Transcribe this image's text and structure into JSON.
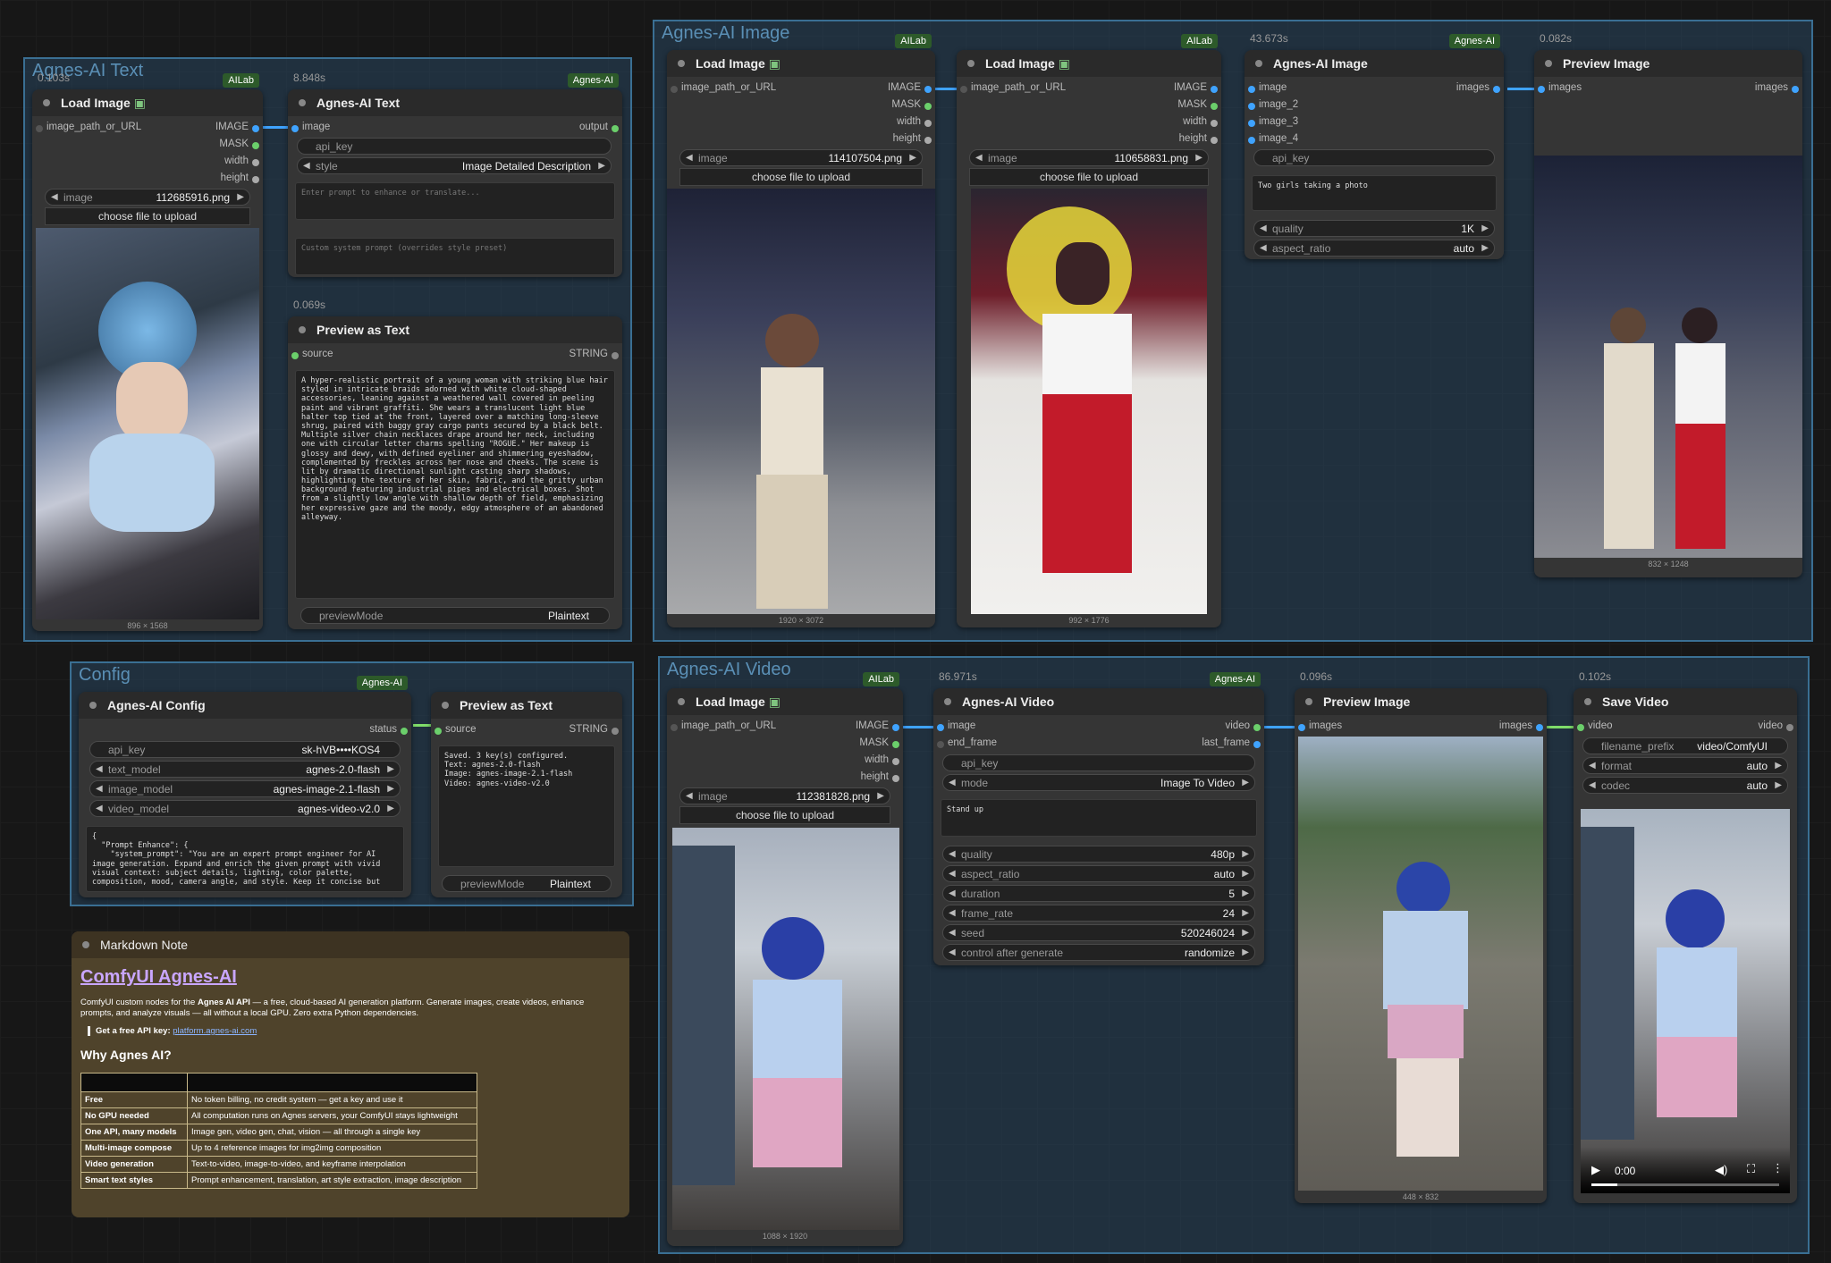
{
  "groups": {
    "text": "Agnes-AI Text",
    "image": "Agnes-AI Image",
    "config": "Config",
    "video": "Agnes-AI Video"
  },
  "colors": {
    "accent": "#3fa3ff",
    "badge": "#2d5a2a",
    "group_border": "#3a6f93"
  },
  "common": {
    "load_image_title": "Load Image",
    "image_path_input": "image_path_or_URL",
    "out_image": "IMAGE",
    "out_mask": "MASK",
    "out_width": "width",
    "out_height": "height",
    "image_label": "image",
    "choose_file": "choose file to upload",
    "badge_allab": "AILab",
    "badge_agnes": "Agnes-AI",
    "preview_image_title": "Preview Image",
    "images": "images",
    "preview_text_title": "Preview as Text",
    "source": "source",
    "string": "STRING",
    "preview_mode": "previewMode",
    "plaintext": "Plaintext",
    "api_key": "api_key"
  },
  "text_group": {
    "load_time": "0.103s",
    "load_filename": "112685916.png",
    "load_dims": "896 × 1568",
    "agnes_time": "8.848s",
    "agnes_title": "Agnes-AI Text",
    "agnes_out": "output",
    "style_label": "style",
    "style_value": "Image Detailed Description",
    "prompt_placeholder": "Enter prompt to enhance or translate...",
    "system_placeholder": "Custom system prompt (overrides style preset)",
    "preview_time": "0.069s",
    "preview_text": "A hyper-realistic portrait of a young woman with striking blue hair styled in intricate braids adorned with white cloud-shaped accessories, leaning against a weathered wall covered in peeling paint and vibrant graffiti. She wears a translucent light blue halter top tied at the front, layered over a matching long-sleeve shrug, paired with baggy gray cargo pants secured by a black belt. Multiple silver chain necklaces drape around her neck, including one with circular letter charms spelling \"ROGUE.\" Her makeup is glossy and dewy, with defined eyeliner and shimmering eyeshadow, complemented by freckles across her nose and cheeks. The scene is lit by dramatic directional sunlight casting sharp shadows, highlighting the texture of her skin, fabric, and the gritty urban background featuring industrial pipes and electrical boxes. Shot from a slightly low angle with shallow depth of field, emphasizing her expressive gaze and the moody, edgy atmosphere of an abandoned alleyway."
  },
  "image_group": {
    "load1_filename": "114107504.png",
    "load1_dims": "1920 × 3072",
    "load2_filename": "110658831.png",
    "load2_dims": "992 × 1776",
    "agnes_time": "43.673s",
    "agnes_title": "Agnes-AI Image",
    "in_image": "image",
    "in_image2": "image_2",
    "in_image3": "image_3",
    "in_image4": "image_4",
    "prompt": "Two girls taking a photo",
    "quality_label": "quality",
    "quality_value": "1K",
    "aspect_label": "aspect_ratio",
    "aspect_value": "auto",
    "preview_time": "0.082s",
    "preview_dims": "832 × 1248"
  },
  "config_group": {
    "title": "Agnes-AI Config",
    "status": "status",
    "api_key_value": "sk-hVB••••KOS4",
    "text_model_label": "text_model",
    "text_model_value": "agnes-2.0-flash",
    "image_model_label": "image_model",
    "image_model_value": "agnes-image-2.1-flash",
    "video_model_label": "video_model",
    "video_model_value": "agnes-video-v2.0",
    "json_text": "{\n  \"Prompt Enhance\": {\n    \"system_prompt\": \"You are an expert prompt engineer for AI image generation. Expand and enrich the given prompt with vivid visual context: subject details, lighting, color palette, composition, mood, camera angle, and style. Keep it concise but",
    "preview_text": "Saved. 3 key(s) configured.\nText: agnes-2.0-flash\nImage: agnes-image-2.1-flash\nVideo: agnes-video-v2.0"
  },
  "note": {
    "header": "Markdown Note",
    "title": "ComfyUI Agnes-AI",
    "intro_pre": "ComfyUI custom nodes for the ",
    "intro_bold": "Agnes AI API",
    "intro_post": " — a free, cloud-based AI generation platform. Generate images, create videos, enhance prompts, and analyze visuals — all without a local GPU. Zero extra Python dependencies.",
    "key_label": "Get a free API key:",
    "key_link": "platform.agnes-ai.com",
    "why": "Why Agnes AI?",
    "rows": [
      {
        "k": "Free",
        "v": "No token billing, no credit system — get a key and use it"
      },
      {
        "k": "No GPU needed",
        "v": "All computation runs on Agnes servers, your ComfyUI stays lightweight"
      },
      {
        "k": "One API, many models",
        "v": "Image gen, video gen, chat, vision — all through a single key"
      },
      {
        "k": "Multi-image compose",
        "v": "Up to 4 reference images for img2img composition"
      },
      {
        "k": "Video generation",
        "v": "Text-to-video, image-to-video, and keyframe interpolation"
      },
      {
        "k": "Smart text styles",
        "v": "Prompt enhancement, translation, art style extraction, image description"
      }
    ]
  },
  "video_group": {
    "load_filename": "112381828.png",
    "load_dims": "1088 × 1920",
    "agnes_time": "86.971s",
    "agnes_title": "Agnes-AI Video",
    "in_image": "image",
    "in_end_frame": "end_frame",
    "out_video": "video",
    "out_last_frame": "last_frame",
    "mode_label": "mode",
    "mode_value": "Image To Video",
    "prompt": "Stand up",
    "quality_label": "quality",
    "quality_value": "480p",
    "aspect_label": "aspect_ratio",
    "aspect_value": "auto",
    "duration_label": "duration",
    "duration_value": "5",
    "frame_rate_label": "frame_rate",
    "frame_rate_value": "24",
    "seed_label": "seed",
    "seed_value": "520246024",
    "control_label": "control after generate",
    "control_value": "randomize",
    "preview_time": "0.096s",
    "preview_dims": "448 × 832",
    "save_time": "0.102s",
    "save_title": "Save Video",
    "video_in": "video",
    "video_out": "video",
    "prefix_label": "filename_prefix",
    "prefix_value": "video/ComfyUI",
    "format_label": "format",
    "format_value": "auto",
    "codec_label": "codec",
    "codec_value": "auto",
    "player_time": "0:00"
  }
}
